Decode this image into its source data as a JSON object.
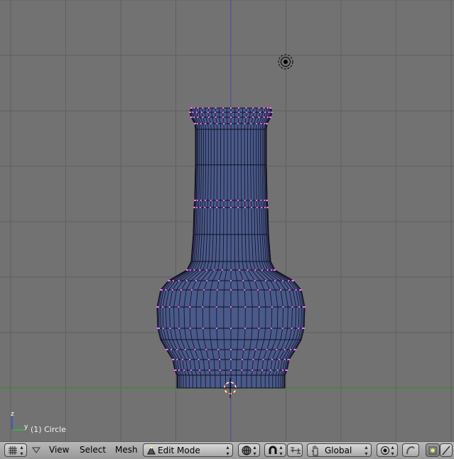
{
  "viewport": {
    "object_label": "(1) Circle",
    "axis_z": "z",
    "axis_y": "y",
    "grid_color": "#606060",
    "background_color": "#727272",
    "mesh_color": "#4a5a8a",
    "vertex_color": "#ff70ff"
  },
  "header": {
    "editor_type_icon": "grid-icon",
    "menus": [
      "View",
      "Select",
      "Mesh"
    ],
    "mode_label": "Edit Mode",
    "orientation_label": "Global"
  }
}
